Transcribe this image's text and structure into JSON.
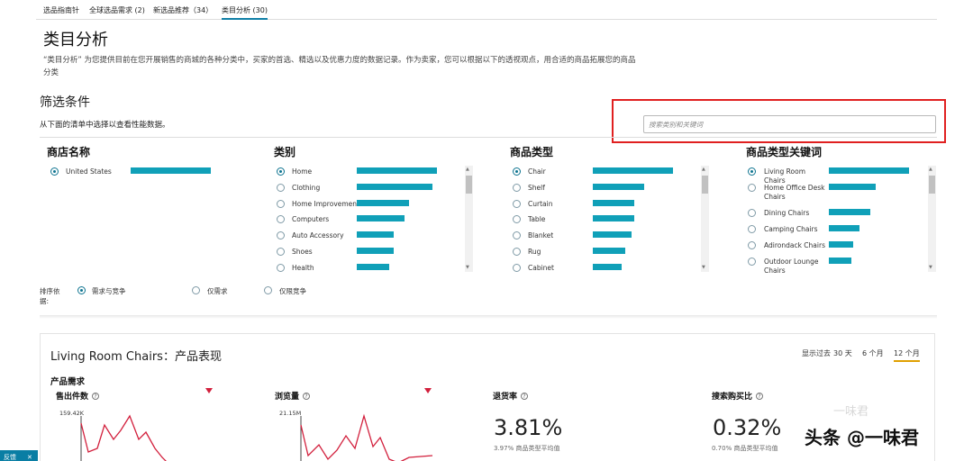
{
  "tabs": [
    {
      "label": "选品指南针"
    },
    {
      "label": "全球选品需求 (2)"
    },
    {
      "label": "新选品推荐（34）"
    },
    {
      "label": "类目分析 (30)"
    }
  ],
  "page": {
    "title": "类目分析",
    "description": "“类目分析” 为您提供目前在您开展销售的商城的各种分类中，买家的首选、精选以及优惠力度的数据记录。作为卖家，您可以根据以下的透视观点，用合适的商品拓展您的商品分类"
  },
  "filter": {
    "title": "筛选条件",
    "subtitle": "从下面的清单中选择以查看性能数据。",
    "search_placeholder": "搜索类别和关键词"
  },
  "columns": {
    "store": {
      "title": "商店名称",
      "items": [
        {
          "label": "United States",
          "value": 1.0,
          "selected": true
        }
      ]
    },
    "category": {
      "title": "类别",
      "items": [
        {
          "label": "Home",
          "value": 1.0,
          "selected": true
        },
        {
          "label": "Clothing",
          "value": 0.94
        },
        {
          "label": "Home Improvement",
          "value": 0.65
        },
        {
          "label": "Computers",
          "value": 0.6
        },
        {
          "label": "Auto Accessory",
          "value": 0.46
        },
        {
          "label": "Shoes",
          "value": 0.46
        },
        {
          "label": "Health",
          "value": 0.4
        }
      ]
    },
    "product_type": {
      "title": "商品类型",
      "items": [
        {
          "label": "Chair",
          "value": 1.0,
          "selected": true
        },
        {
          "label": "Shelf",
          "value": 0.64
        },
        {
          "label": "Curtain",
          "value": 0.52
        },
        {
          "label": "Table",
          "value": 0.52
        },
        {
          "label": "Blanket",
          "value": 0.48
        },
        {
          "label": "Rug",
          "value": 0.4
        },
        {
          "label": "Cabinet",
          "value": 0.36
        }
      ]
    },
    "keywords": {
      "title": "商品类型关键词",
      "items": [
        {
          "label": "Living Room Chairs",
          "value": 1.0,
          "selected": true
        },
        {
          "label": "Home Office Desk Chairs",
          "value": 0.58
        },
        {
          "label": "Dining Chairs",
          "value": 0.52
        },
        {
          "label": "Camping Chairs",
          "value": 0.38
        },
        {
          "label": "Adirondack Chairs",
          "value": 0.3
        },
        {
          "label": "Outdoor Lounge Chairs",
          "value": 0.28
        }
      ]
    }
  },
  "sort": {
    "label": "排序依据:",
    "options": [
      {
        "label": "需求与竞争",
        "selected": true
      },
      {
        "label": "仅需求"
      },
      {
        "label": "仅限竞争"
      }
    ]
  },
  "performance": {
    "title": "Living Room Chairs：产品表现",
    "period_label": "显示过去",
    "periods": [
      {
        "label": "30 天"
      },
      {
        "label": "6 个月"
      },
      {
        "label": "12 个月",
        "active": true
      }
    ],
    "section": "产品需求",
    "metrics": [
      {
        "title": "售出件数",
        "ymax": "159.42K"
      },
      {
        "title": "浏览量",
        "ymax": "21.15M"
      },
      {
        "title": "退货率",
        "value": "3.81%",
        "note": "3.97% 商品类型平均值"
      },
      {
        "title": "搜索购买比",
        "value": "0.32%",
        "note": "0.70% 商品类型平均值"
      }
    ]
  },
  "feedback": {
    "label": "反馈",
    "close": "✕"
  },
  "watermark": {
    "text": "头条 @一味君",
    "logo": "一味君"
  },
  "colors": {
    "accent": "#0e7490",
    "bar": "#10a0b8",
    "trend": "#d21f3c",
    "highlight": "#e02020"
  }
}
